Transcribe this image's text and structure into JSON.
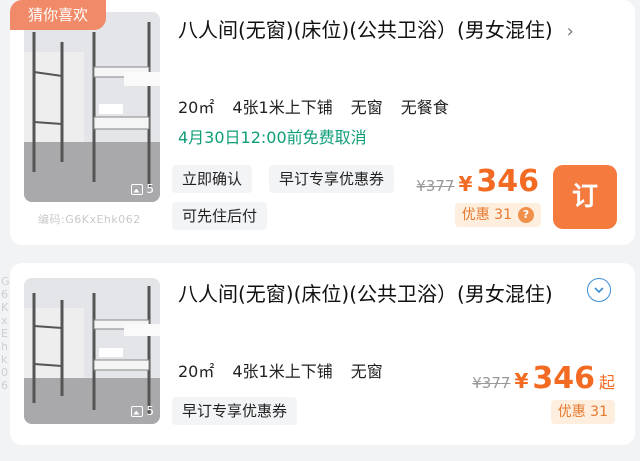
{
  "listing1": {
    "badge": "猜你喜欢",
    "image_count": "5",
    "watermark": "编码:G6KxEhk062",
    "title": "八人间(无窗)(床位)(公共卫浴）(男女混住)",
    "chevron": "›",
    "specs": [
      "20㎡",
      "4张1米上下铺",
      "无窗",
      "无餐食"
    ],
    "cancel_policy": "4月30日12:00前免费取消",
    "tags": [
      "立即确认",
      "早订专享优惠券",
      "可先住后付"
    ],
    "original_price": "¥377",
    "currency": "¥",
    "price": "346",
    "discount": "优惠 31",
    "discount_icon": "?",
    "book_label": "订"
  },
  "listing2": {
    "image_count": "5",
    "side_watermark": "G6KxEhk06",
    "title": "八人间(无窗)(床位)(公共卫浴）(男女混住)",
    "specs": [
      "20㎡",
      "4张1米上下铺",
      "无窗"
    ],
    "tags": [
      "早订专享优惠券"
    ],
    "original_price": "¥377",
    "currency": "¥",
    "price": "346",
    "price_suffix": "起",
    "discount": "优惠 31"
  },
  "colors": {
    "accent": "#f47a3e",
    "price": "#f36a22",
    "cancel_green": "#0f9e78",
    "badge": "#f08a68",
    "expand_blue": "#3a8fd8"
  },
  "icons": {
    "image_count": "image-icon",
    "chevron": "chevron-right-icon",
    "expand": "chevron-down-circle-icon",
    "discount_info": "question-icon"
  }
}
